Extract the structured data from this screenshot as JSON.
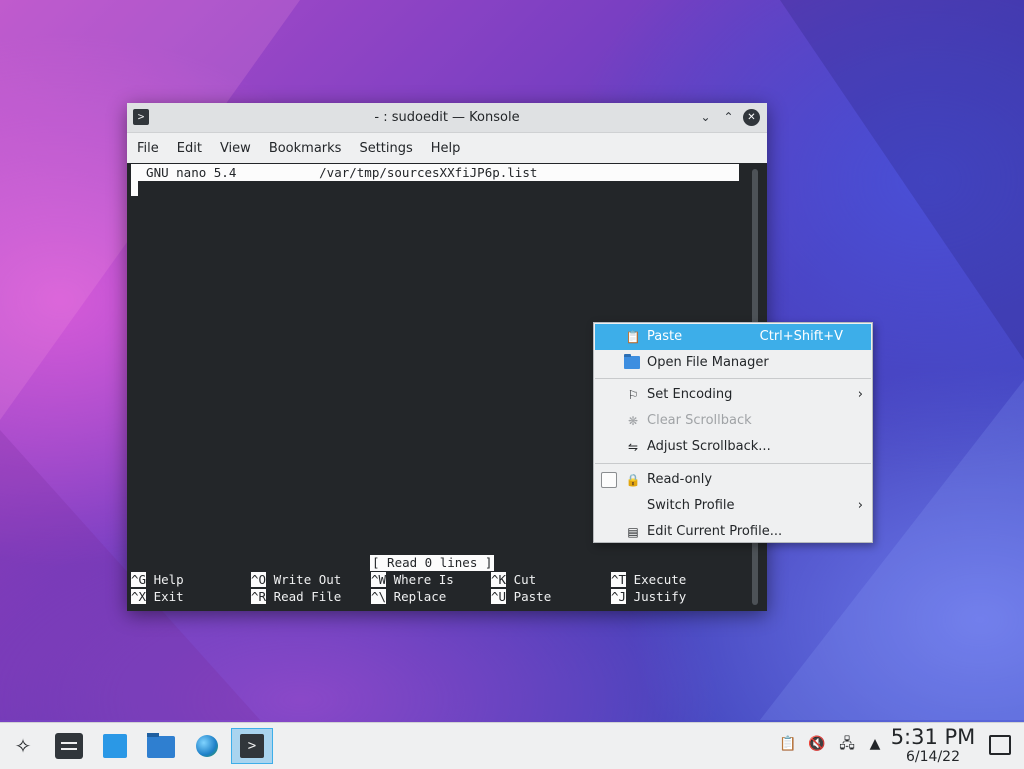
{
  "window": {
    "title": "- : sudoedit — Konsole",
    "menu": [
      "File",
      "Edit",
      "View",
      "Bookmarks",
      "Settings",
      "Help"
    ]
  },
  "nano": {
    "header": "  GNU nano 5.4           /var/tmp/sourcesXXfiJP6p.list",
    "status": "[ Read 0 lines ]",
    "shortcuts": [
      {
        "key": "^G",
        "label": " Help"
      },
      {
        "key": "^O",
        "label": " Write Out"
      },
      {
        "key": "^W",
        "label": " Where Is"
      },
      {
        "key": "^K",
        "label": " Cut"
      },
      {
        "key": "^T",
        "label": " Execute"
      },
      {
        "key": "^X",
        "label": " Exit"
      },
      {
        "key": "^R",
        "label": " Read File"
      },
      {
        "key": "^\\",
        "label": " Replace"
      },
      {
        "key": "^U",
        "label": " Paste"
      },
      {
        "key": "^J",
        "label": " Justify"
      }
    ]
  },
  "context_menu": {
    "paste": {
      "label": "Paste",
      "shortcut": "Ctrl+Shift+V"
    },
    "open_file_manager": {
      "label": "Open File Manager"
    },
    "set_encoding": {
      "label": "Set Encoding"
    },
    "clear_scrollback": {
      "label": "Clear Scrollback"
    },
    "adjust_scrollback": {
      "label": "Adjust Scrollback..."
    },
    "read_only": {
      "label": "Read-only",
      "checked": false
    },
    "switch_profile": {
      "label": "Switch Profile"
    },
    "edit_profile": {
      "label": "Edit Current Profile..."
    }
  },
  "taskbar": {
    "clock_time": "5:31 PM",
    "clock_date": "6/14/22"
  },
  "colors": {
    "highlight": "#3daee9",
    "terminal_bg": "#232629",
    "panel_bg": "#eff0f1"
  }
}
